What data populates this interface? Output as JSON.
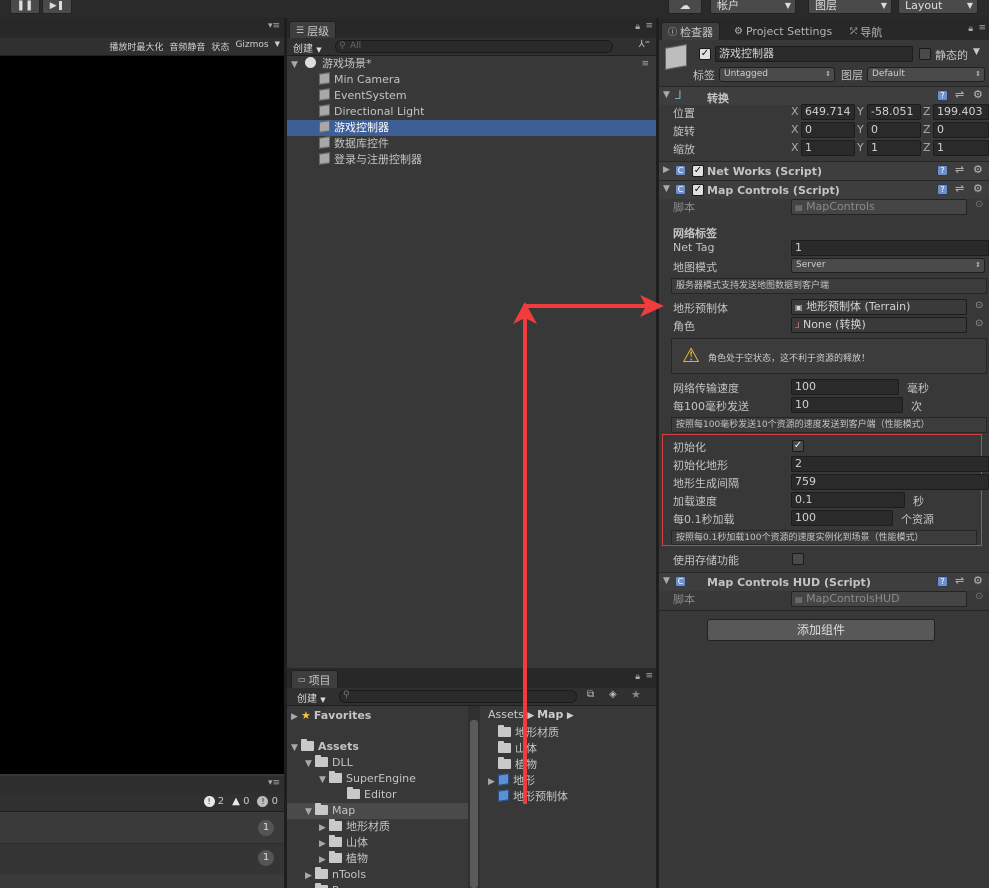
{
  "topbar": {
    "account_label": "帐户",
    "layers_label": "图层",
    "layout_label": "Layout"
  },
  "game_view": {
    "toolbar_items": [
      "播放时最大化",
      "音频静音",
      "状态",
      "Gizmos"
    ]
  },
  "console": {
    "counts": [
      "2",
      "0",
      "0"
    ],
    "row_badges": [
      "1",
      "1"
    ]
  },
  "hierarchy": {
    "tab_label": "层级",
    "create_label": "创建",
    "search_placeholder": "All",
    "scene_name": "游戏场景*",
    "items": [
      {
        "label": "Min Camera",
        "selected": false
      },
      {
        "label": "EventSystem",
        "selected": false
      },
      {
        "label": "Directional Light",
        "selected": false
      },
      {
        "label": "游戏控制器",
        "selected": true
      },
      {
        "label": "数据库控件",
        "selected": false
      },
      {
        "label": "登录与注册控制器",
        "selected": false
      }
    ]
  },
  "project": {
    "tab_label": "项目",
    "create_label": "创建",
    "tree": [
      {
        "label": "Favorites",
        "kind": "favorites"
      },
      {
        "label": "Assets",
        "kind": "root"
      },
      {
        "label": "DLL",
        "kind": "folder"
      },
      {
        "label": "SuperEngine",
        "kind": "folder"
      },
      {
        "label": "Editor",
        "kind": "folder"
      },
      {
        "label": "Map",
        "kind": "folder"
      },
      {
        "label": "地形材质",
        "kind": "folder"
      },
      {
        "label": "山体",
        "kind": "folder"
      },
      {
        "label": "植物",
        "kind": "folder"
      },
      {
        "label": "nTools",
        "kind": "folder"
      },
      {
        "label": "P",
        "kind": "folder"
      }
    ],
    "breadcrumb": [
      "Assets",
      "Map"
    ],
    "files": [
      {
        "label": "地形材质",
        "kind": "folder"
      },
      {
        "label": "山体",
        "kind": "folder"
      },
      {
        "label": "植物",
        "kind": "folder"
      },
      {
        "label": "地形",
        "kind": "prefab"
      },
      {
        "label": "地形预制体",
        "kind": "prefab"
      }
    ]
  },
  "inspector": {
    "tabs": [
      "检查器",
      "Project Settings",
      "导航"
    ],
    "object_name": "游戏控制器",
    "static_label": "静态的",
    "tag_label": "标签",
    "tag_value": "Untagged",
    "layer_label": "图层",
    "layer_value": "Default",
    "transform": {
      "title": "转换",
      "position_label": "位置",
      "rotation_label": "旋转",
      "scale_label": "缩放",
      "position": [
        "649.714",
        "-58.051",
        "199.403"
      ],
      "rotation": [
        "0",
        "0",
        "0"
      ],
      "scale": [
        "1",
        "1",
        "1"
      ]
    },
    "net_works": {
      "title": "Net Works (Script)"
    },
    "map_controls": {
      "title": "Map Controls (Script)",
      "script_label": "脚本",
      "script_value": "MapControls",
      "section_title": "网络标签",
      "net_tag_label": "Net Tag",
      "net_tag_value": "1",
      "map_mode_label": "地图模式",
      "map_mode_value": "Server",
      "help_server": "服务器模式支持发送地图数据到客户端",
      "terrain_prefab_label": "地形预制体",
      "terrain_prefab_value": "地形预制体 (Terrain)",
      "role_label": "角色",
      "role_value": "None (转换)",
      "warning_text": "角色处于空状态，这不利于资源的释放！",
      "net_speed_label": "网络传输速度",
      "net_speed_value": "100",
      "net_speed_unit": "毫秒",
      "per100_label": "每100毫秒发送",
      "per100_value": "10",
      "per100_unit": "次",
      "help_send": "按照每100毫秒发送10个资源的速度发送到客户端（性能模式）",
      "init_label": "初始化",
      "init_checked": true,
      "init_terrain_label": "初始化地形",
      "init_terrain_value": "2",
      "gen_interval_label": "地形生成间隔",
      "gen_interval_value": "759",
      "load_speed_label": "加载速度",
      "load_speed_value": "0.1",
      "load_speed_unit": "秒",
      "per01_label": "每0.1秒加载",
      "per01_value": "100",
      "per01_unit": "个资源",
      "help_load": "按照每0.1秒加载100个资源的速度实例化到场景（性能模式）",
      "storage_label": "使用存储功能",
      "storage_checked": false
    },
    "hud": {
      "title": "Map Controls HUD (Script)",
      "script_label": "脚本",
      "script_value": "MapControlsHUD"
    },
    "add_component_label": "添加组件"
  },
  "colors": {
    "selection": "#3e5f96",
    "annotation_red": "#f03c3c",
    "panel_bg": "#383838"
  }
}
